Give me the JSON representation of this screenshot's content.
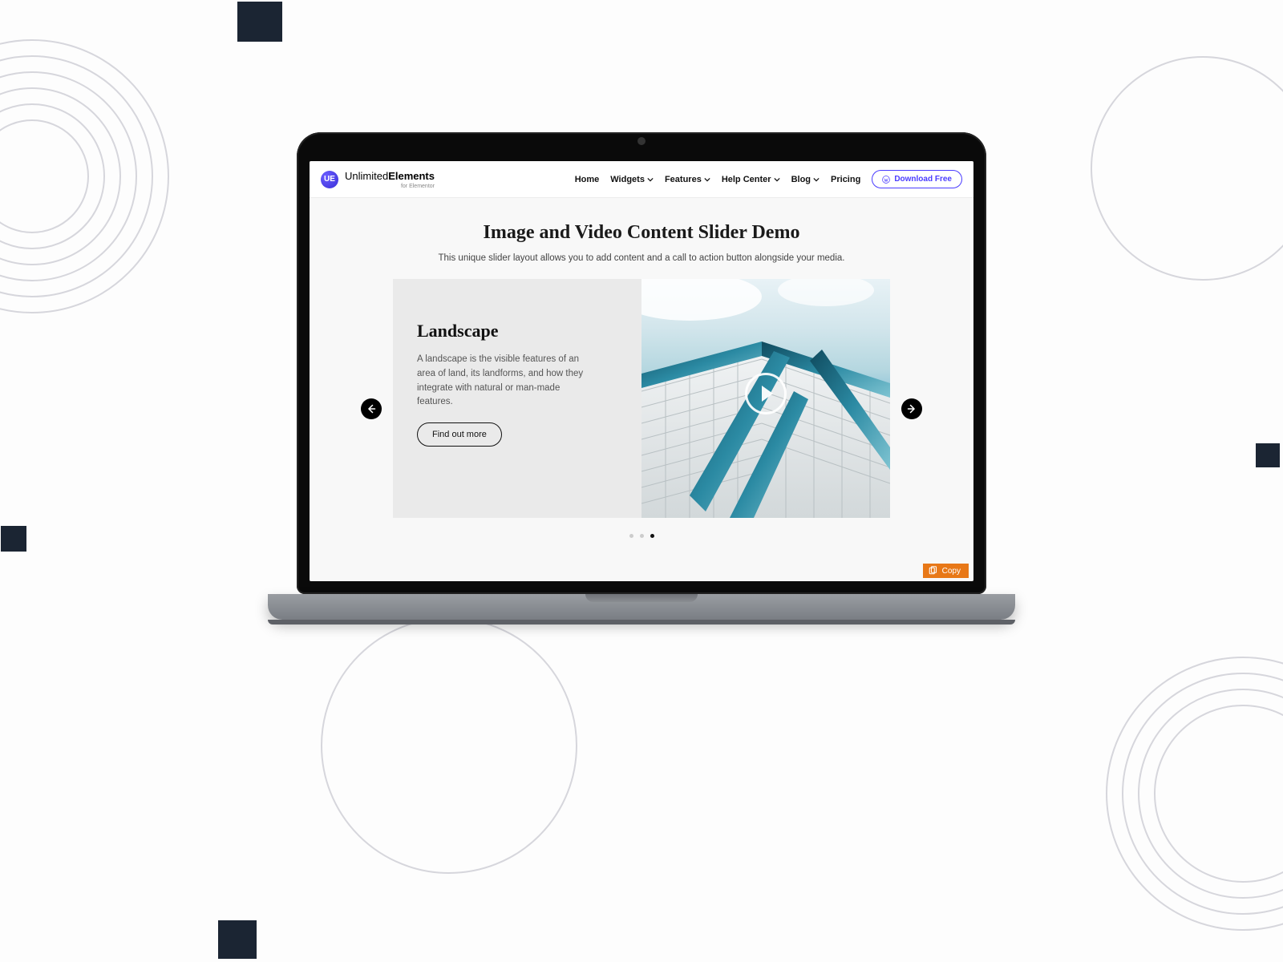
{
  "brand": {
    "text1": "Unlimited",
    "text2": "Elements",
    "tagline": "for Elementor",
    "badge": "UE"
  },
  "nav": {
    "items": [
      {
        "label": "Home",
        "dropdown": false
      },
      {
        "label": "Widgets",
        "dropdown": true
      },
      {
        "label": "Features",
        "dropdown": true
      },
      {
        "label": "Help Center",
        "dropdown": true
      },
      {
        "label": "Blog",
        "dropdown": true
      },
      {
        "label": "Pricing",
        "dropdown": false
      }
    ],
    "download": "Download Free"
  },
  "page": {
    "title": "Image and Video Content Slider Demo",
    "subtitle": "This unique slider layout allows you to add content and a call to action button alongside your media."
  },
  "slide": {
    "title": "Landscape",
    "description": "A landscape is the visible features of an area of land, its landforms, and how they integrate with natural or man-made features.",
    "button": "Find out more"
  },
  "slider": {
    "dot_count": 3,
    "active_dot": 2
  },
  "copy_label": "Copy"
}
